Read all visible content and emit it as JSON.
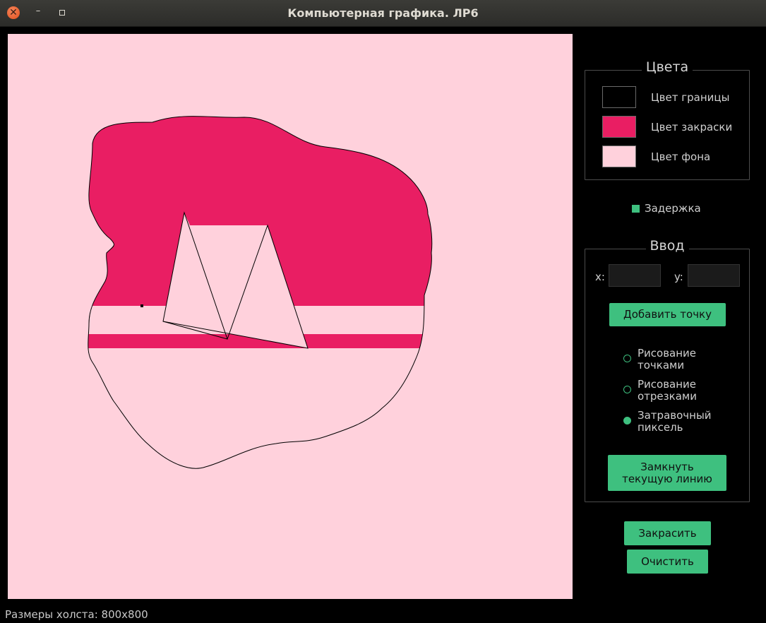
{
  "window": {
    "title": "Компьютерная графика. ЛР6",
    "close_glyph": "✕",
    "minimize_glyph": "–"
  },
  "colors_group": {
    "title": "Цвета",
    "items": [
      {
        "label": "Цвет границы",
        "color": "#000000"
      },
      {
        "label": "Цвет закраски",
        "color": "#E91E63"
      },
      {
        "label": "Цвет фона",
        "color": "#FFD1DC"
      }
    ]
  },
  "delay": {
    "label": "Задержка",
    "checked": true
  },
  "input_group": {
    "title": "Ввод",
    "x_label": "x:",
    "y_label": "y:",
    "x_value": "",
    "y_value": "",
    "add_point_label": "Добавить точку",
    "modes": [
      {
        "label": "Рисование\nточками",
        "checked": false
      },
      {
        "label": "Рисование\nотрезками",
        "checked": false
      },
      {
        "label": "Затравочный\nпиксель",
        "checked": true
      }
    ],
    "close_line_label": "Замкнуть\nтекущую линию"
  },
  "fill_button_label": "Закрасить",
  "clear_button_label": "Очистить",
  "status": "Размеры холста: 800x800",
  "theme": {
    "accent": "#3EC07F",
    "canvas_background": "#FFD1DC",
    "fill_color": "#E91E63",
    "border_color": "#000000"
  }
}
